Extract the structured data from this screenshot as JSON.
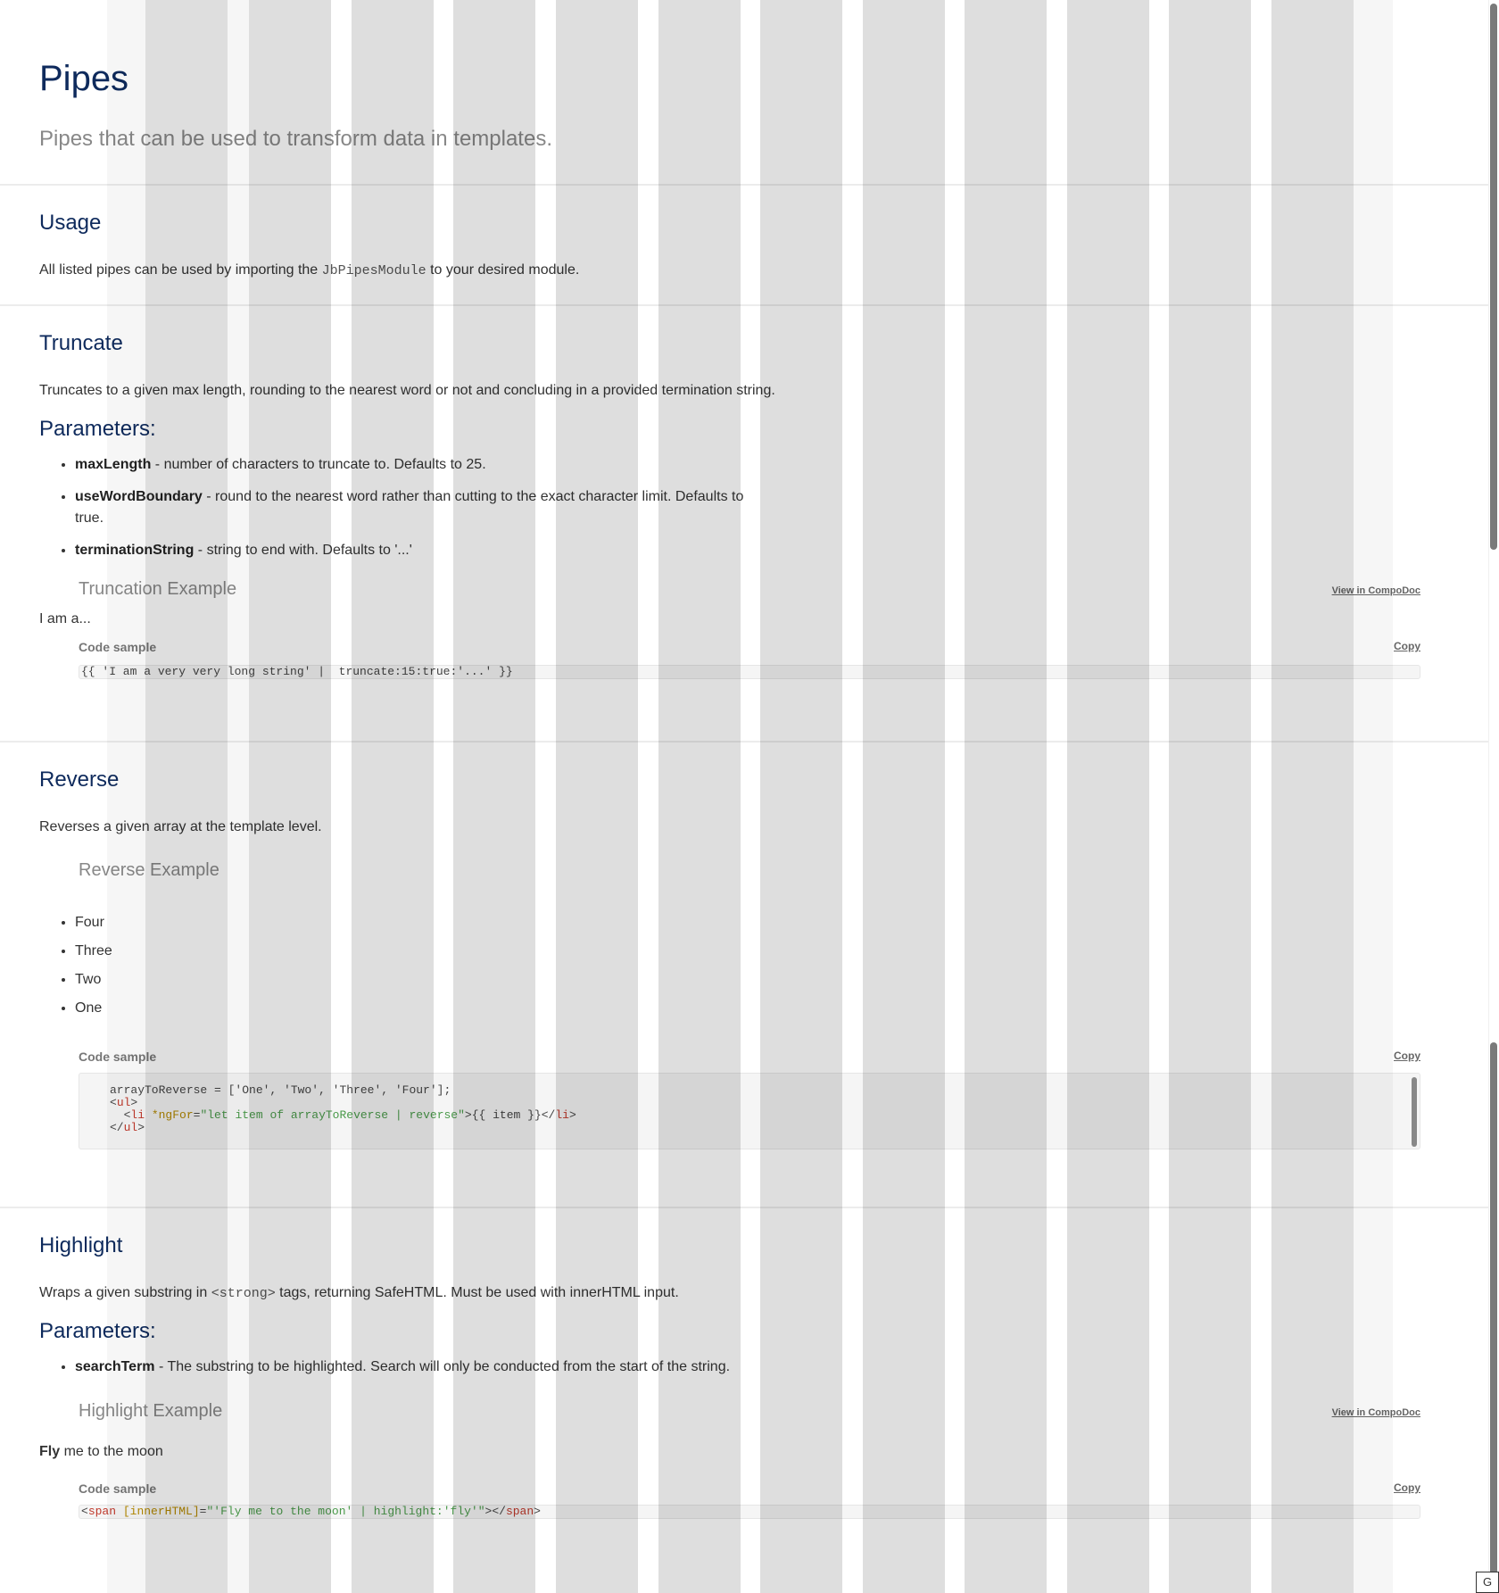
{
  "header": {
    "title": "Pipes",
    "subtitle": "Pipes that can be used to transform data in templates."
  },
  "usage": {
    "title": "Usage",
    "text_before": "All listed pipes can be used by importing the ",
    "code": "JbPipesModule",
    "text_after": " to your desired module."
  },
  "truncate": {
    "title": "Truncate",
    "description": "Truncates to a given max length, rounding to the nearest word or not and concluding in a provided termination string.",
    "params_title": "Parameters:",
    "params": [
      {
        "name": "maxLength",
        "desc": " - number of characters to truncate to. Defaults to 25."
      },
      {
        "name": "useWordBoundary",
        "desc": " - round to the nearest word rather than cutting to the exact character limit. Defaults to true."
      },
      {
        "name": "terminationString",
        "desc": " - string to end with. Defaults to '...'"
      }
    ],
    "example_title": "Truncation Example",
    "view_link": "View in CompoDoc",
    "result": "I am a...",
    "code_label": "Code sample",
    "copy": "Copy",
    "code": "{{ 'I am a very very long string' |  truncate:15:true:'...' }}"
  },
  "reverse": {
    "title": "Reverse",
    "description": "Reverses a given array at the template level.",
    "example_title": "Reverse Example",
    "items": [
      "Four",
      "Three",
      "Two",
      "One"
    ],
    "code_label": "Code sample",
    "copy": "Copy",
    "code_line1": "arrayToReverse = ['One', 'Two', 'Three', 'Four'];",
    "code_ul_open": "ul",
    "code_li": "li",
    "code_attr": "*ngFor",
    "code_attr_val": "\"let item of arrayToReverse | reverse\"",
    "code_li_content": ">{{ item }}</",
    "code_ul_close": "ul"
  },
  "highlight": {
    "title": "Highlight",
    "text_before": "Wraps a given substring in ",
    "code": "<strong>",
    "text_after": " tags, returning SafeHTML. Must be used with innerHTML input.",
    "params_title": "Parameters:",
    "params": [
      {
        "name": "searchTerm",
        "desc": " - The substring to be highlighted. Search will only be conducted from the start of the string."
      }
    ],
    "example_title": "Highlight Example",
    "view_link": "View in CompoDoc",
    "result_bold": "Fly",
    "result_rest": " me to the moon",
    "code_label": "Code sample",
    "copy": "Copy",
    "code_tag": "span",
    "code_attr": "[innerHTML]",
    "code_val": "\"'Fly me to the moon' | highlight:'fly'\"",
    "code_close_tag": "span"
  },
  "corner_badge": "G"
}
